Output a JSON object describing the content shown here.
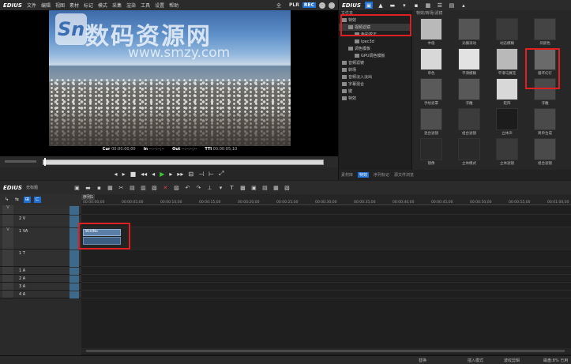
{
  "app": {
    "logo": "EDIUS"
  },
  "menu": {
    "items": [
      "文件",
      "编辑",
      "视图",
      "素材",
      "标记",
      "模式",
      "采集",
      "渲染",
      "工具",
      "设置",
      "帮助"
    ],
    "all_label": "全",
    "plr_label": "PLR",
    "rec_label": "REC"
  },
  "preview": {
    "watermark_logo": "Sn",
    "watermark_text": "数码资源网",
    "watermark_url": "www.smzy.com",
    "timecode": {
      "cur_label": "Cur",
      "cur": "00:00:00;00",
      "in_label": "In",
      "in": "--:--:--;--",
      "out_label": "Out",
      "out": "--:--:--;--",
      "tt_label": "TTl",
      "tt": "00:00:05;10"
    }
  },
  "transport": {
    "buttons": [
      "◂",
      "▸",
      "■",
      "◂◂",
      "◂",
      "▶",
      "▸",
      "▸▸",
      "⊟",
      "⊣",
      "⊢",
      "⤢"
    ]
  },
  "effects": {
    "logo": "EDIUS",
    "folder_header": "文件夹",
    "path_header": "特效/转场/滤镜",
    "tree": [
      {
        "label": "特效",
        "level": 0
      },
      {
        "label": "视频滤镜",
        "level": 1,
        "selected": true
      },
      {
        "label": "色彩校正",
        "level": 2
      },
      {
        "label": "Ipec3d",
        "level": 2
      },
      {
        "label": "调色模板",
        "level": 1
      },
      {
        "label": "GPU调色模板",
        "level": 2
      },
      {
        "label": "音频滤镜",
        "level": 0
      },
      {
        "label": "转场",
        "level": 0
      },
      {
        "label": "音频淡入淡出",
        "level": 0
      },
      {
        "label": "字幕混合",
        "level": 0
      },
      {
        "label": "键",
        "level": 0
      },
      {
        "label": "特效",
        "level": 0
      }
    ],
    "tiles": [
      "中值",
      "光栅滚动",
      "动态模糊",
      "块颜色",
      "单色",
      "平滑模糊",
      "平滑马赛克",
      "循环幻灯",
      "手绘遮罩",
      "浮雕",
      "矩阵",
      "浮雕",
      "混合滤镜",
      "组合滤镜",
      "立体声",
      "简单合成",
      "镜像",
      "立体模式",
      "立体滤镜",
      "组合滤镜"
    ],
    "tabs": [
      "素材库",
      "特效",
      "序列标记",
      "源文件浏览"
    ]
  },
  "timeline": {
    "logo": "EDIUS",
    "sequence_tab": "序列1",
    "subtitle": "无标题",
    "ruler_ticks": [
      "00:00:00;00",
      "00:00:05;00",
      "00:00:10;00",
      "00:00:15;00",
      "00:00:20;00",
      "00:00:25;00",
      "00:00:30;00",
      "00:00:35;00",
      "00:00:40;00",
      "00:00:45;00",
      "00:00:50;00",
      "00:00:55;00",
      "00:01:00;00"
    ],
    "tracks": [
      {
        "name": "",
        "side": "V"
      },
      {
        "name": "2 V",
        "side": ""
      },
      {
        "name": "1 VA",
        "side": "V"
      },
      {
        "name": "1 T",
        "side": ""
      },
      {
        "name": "1 A",
        "side": ""
      },
      {
        "name": "2 A",
        "side": ""
      },
      {
        "name": "3 A",
        "side": ""
      },
      {
        "name": "4 A",
        "side": ""
      }
    ],
    "clip_label": "WildNo"
  },
  "status": {
    "mode": "替换",
    "insert": "插入模式",
    "ripple": "波纹剪辑",
    "disk": "磁盘:8% 已用"
  },
  "colors": {
    "accent": "#1d6fd1",
    "highlight": "#e02020",
    "clip": "#5b7fa6"
  }
}
